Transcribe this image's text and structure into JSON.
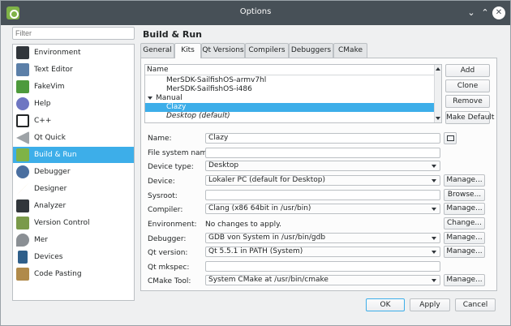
{
  "window": {
    "title": "Options"
  },
  "titlebar": {
    "minimize": "⌄",
    "maximize": "⌃",
    "close": "✕"
  },
  "filter": {
    "placeholder": "Filter"
  },
  "sidebar": {
    "items": [
      {
        "label": "Environment",
        "icon": "environment-icon",
        "color": "#31363b"
      },
      {
        "label": "Text Editor",
        "icon": "text-editor-icon",
        "color": "#5b7fa8"
      },
      {
        "label": "FakeVim",
        "icon": "fakevim-icon",
        "color": "#4d9a3c"
      },
      {
        "label": "Help",
        "icon": "help-icon",
        "color": "#6e76c2"
      },
      {
        "label": "C++",
        "icon": "cpp-icon",
        "color": "#232627"
      },
      {
        "label": "Qt Quick",
        "icon": "qt-quick-icon",
        "color": "#9ea3a7"
      },
      {
        "label": "Build & Run",
        "icon": "build-run-icon",
        "color": "#7fb347"
      },
      {
        "label": "Debugger",
        "icon": "debugger-icon",
        "color": "#4a6fa0"
      },
      {
        "label": "Designer",
        "icon": "designer-icon",
        "color": "#c99e3e"
      },
      {
        "label": "Analyzer",
        "icon": "analyzer-icon",
        "color": "#31363b"
      },
      {
        "label": "Version Control",
        "icon": "version-control-icon",
        "color": "#7a9a4a"
      },
      {
        "label": "Mer",
        "icon": "mer-icon",
        "color": "#8a8f94"
      },
      {
        "label": "Devices",
        "icon": "devices-icon",
        "color": "#2f5f8a"
      },
      {
        "label": "Code Pasting",
        "icon": "code-pasting-icon",
        "color": "#b08a4a"
      }
    ],
    "active_index": 6
  },
  "main": {
    "title": "Build & Run",
    "tabs": [
      "General",
      "Kits",
      "Qt Versions",
      "Compilers",
      "Debuggers",
      "CMake"
    ],
    "active_tab": 1
  },
  "kits_tree": {
    "header": "Name",
    "rows": [
      {
        "label": "MerSDK-SailfishOS-armv7hl",
        "indent": 2
      },
      {
        "label": "MerSDK-SailfishOS-i486",
        "indent": 2
      },
      {
        "label": "Manual",
        "indent": 1,
        "expanded": true
      },
      {
        "label": "Clazy",
        "indent": 2,
        "selected": true
      },
      {
        "label": "Desktop (default)",
        "indent": 2,
        "italic": true
      }
    ]
  },
  "kit_buttons": {
    "add": "Add",
    "clone": "Clone",
    "remove": "Remove",
    "make_default": "Make Default"
  },
  "form": {
    "name": {
      "label": "Name:",
      "value": "Clazy"
    },
    "file_system_name": {
      "label": "File system name:",
      "value": ""
    },
    "device_type": {
      "label": "Device type:",
      "value": "Desktop"
    },
    "device": {
      "label": "Device:",
      "value": "Lokaler PC (default for Desktop)",
      "button": "Manage..."
    },
    "sysroot": {
      "label": "Sysroot:",
      "value": "",
      "button": "Browse..."
    },
    "compiler": {
      "label": "Compiler:",
      "value": "Clang (x86 64bit in /usr/bin)",
      "button": "Manage..."
    },
    "environment": {
      "label": "Environment:",
      "value": "No changes to apply.",
      "button": "Change..."
    },
    "debugger": {
      "label": "Debugger:",
      "value": "GDB von System in /usr/bin/gdb",
      "button": "Manage..."
    },
    "qt_version": {
      "label": "Qt version:",
      "value": "Qt 5.5.1 in PATH (System)",
      "button": "Manage..."
    },
    "qt_mkspec": {
      "label": "Qt mkspec:",
      "value": ""
    },
    "cmake_tool": {
      "label": "CMake Tool:",
      "value": "System CMake at /usr/bin/cmake",
      "button": "Manage..."
    }
  },
  "dialog_buttons": {
    "ok": "OK",
    "apply": "Apply",
    "cancel": "Cancel"
  },
  "colors": {
    "accent": "#3daee9",
    "titlebar": "#475057",
    "window_bg": "#eff0f1"
  }
}
